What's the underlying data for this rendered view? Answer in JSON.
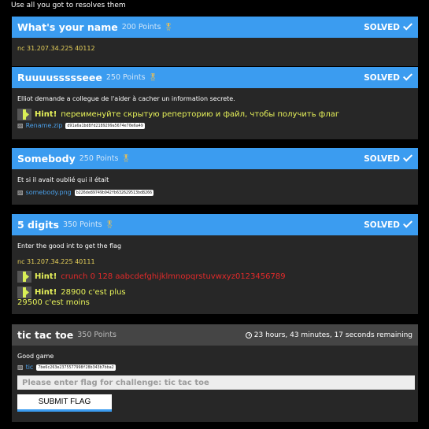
{
  "intro": "Use all you got to resolves them",
  "status_label": "SOLVED",
  "challenges": [
    {
      "title": "What's your name",
      "points": "200 Points",
      "solved": true,
      "nc": "nc 31.207.34.225 40112"
    },
    {
      "title": "Ruuuussssseee",
      "points": "250 Points",
      "solved": true,
      "description": "Elliot demande a collegue de l'aider à cacher un information secrete.",
      "hint_label": "Hint!",
      "hint_text": "переименуйте скрытую реперторию и файл, чтобы получить флаг",
      "file_name": "Rename.zip",
      "file_hash": "d91a6a1bd8fd2189299a5674e70e6a49"
    },
    {
      "title": "Somebody",
      "points": "250 Points",
      "solved": true,
      "description": "Et si il avait oublié qui il était",
      "file_name": "somebody.png",
      "file_hash": "b226de89749b942fb632629513bd8266"
    },
    {
      "title": "5 digits",
      "points": "350 Points",
      "solved": true,
      "description": "Enter the good int to get the flag",
      "nc": "nc 31.207.34.225 40111",
      "hint1_label": "Hint!",
      "hint1_text": "crunch 0 128 aabcdefghijklmnopqrstuvwxyz0123456789",
      "hint2_label": "Hint!",
      "hint2_text": "28900 c'est plus",
      "hint2_extra": "29500 c'est moins"
    },
    {
      "title": "tic tac toe",
      "points": "350 Points",
      "solved": false,
      "timer": "23 hours, 43 minutes, 17 seconds remaining",
      "description": "Good game",
      "file_name": "tic",
      "file_hash": "7be6c263e2375577998f28b343b7bba2",
      "flag_placeholder": "Please enter flag for challenge: tic tac toe",
      "submit_label": "SUBMIT FLAG"
    }
  ],
  "colors": {
    "solved_header": "#3b9cf0",
    "open_header": "#454545",
    "card_bg": "#272727",
    "hint_yellow": "#e8f35a",
    "hint_red": "#e22a2a",
    "nc_yellow": "#e6d05a",
    "link_blue": "#4a9fe8"
  },
  "icons": {
    "medal": "medal-icon",
    "check": "check-icon",
    "clock": "clock-icon",
    "file": "file-icon",
    "hint_arrow": "hint-arrow-icon"
  }
}
